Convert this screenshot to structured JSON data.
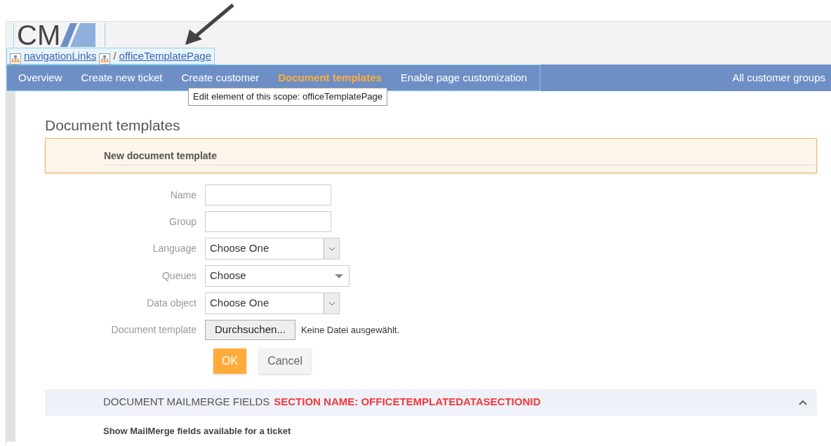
{
  "logo": {
    "text": "CM"
  },
  "breadcrumb": {
    "items": [
      {
        "label": "navigationLinks"
      },
      {
        "label": "officeTemplatePage"
      }
    ],
    "separator": "/"
  },
  "nav": {
    "items": [
      {
        "label": "Overview",
        "selected": false
      },
      {
        "label": "Create new ticket",
        "selected": false
      },
      {
        "label": "Create customer",
        "selected": false
      },
      {
        "label": "Document templates",
        "selected": true
      },
      {
        "label": "Enable page customization",
        "selected": false
      }
    ],
    "right": "All customer groups"
  },
  "tooltip": "Edit element of this scope: officeTemplatePage",
  "page_title": "Document templates",
  "panel_title": "New document template",
  "form": {
    "fields": [
      {
        "kind": "text",
        "label": "Name"
      },
      {
        "kind": "text",
        "label": "Group"
      },
      {
        "kind": "select",
        "label": "Language",
        "value": "Choose One"
      },
      {
        "kind": "combo",
        "label": "Queues",
        "value": "Choose"
      },
      {
        "kind": "select",
        "label": "Data object",
        "value": "Choose One"
      },
      {
        "kind": "file",
        "label": "Document template",
        "button": "Durchsuchen...",
        "status": "Keine Datei ausgewählt."
      }
    ],
    "buttons": [
      {
        "label": "OK",
        "kind": "primary"
      },
      {
        "label": "Cancel",
        "kind": "secondary"
      }
    ]
  },
  "section": {
    "title": "DOCUMENT MAILMERGE FIELDS",
    "name": "SECTION NAME: OFFICETEMPLATEDATASECTIONID",
    "expanded": true
  },
  "section_text": "Show MailMerge fields available for a ticket"
}
